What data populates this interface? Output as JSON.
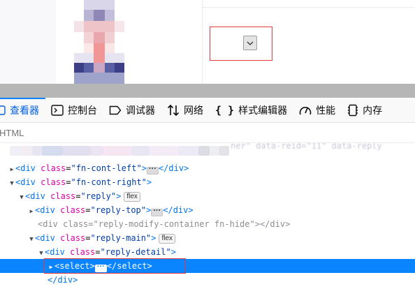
{
  "tabs": [
    {
      "label": "查看器",
      "icon": "inspector-icon",
      "selected": true
    },
    {
      "label": "控制台",
      "icon": "console-icon",
      "selected": false
    },
    {
      "label": "调试器",
      "icon": "debugger-icon",
      "selected": false
    },
    {
      "label": "网络",
      "icon": "network-icon",
      "selected": false
    },
    {
      "label": "样式编辑器",
      "icon": "style-editor-icon",
      "selected": false
    },
    {
      "label": "性能",
      "icon": "performance-icon",
      "selected": false
    },
    {
      "label": "内存",
      "icon": "memory-icon",
      "selected": false
    }
  ],
  "breadcrumb": "HTML",
  "colors": {
    "selection": "#0a84ff",
    "highlight_outline": "#e33b3b",
    "tag": "#0074e8",
    "attr_name": "#dd00a9",
    "attr_value": "#003eaa"
  },
  "tree": {
    "partial_top": "ner\" data-reid=\"11\" data-reply",
    "lines": {
      "l1": {
        "tag": "div",
        "attr": "class",
        "value": "fn-cont-left",
        "close": "</div>"
      },
      "l2": {
        "tag": "div",
        "attr": "class",
        "value": "fn-cont-right"
      },
      "l3": {
        "tag": "div",
        "attr": "class",
        "value": "reply",
        "badge": "flex"
      },
      "l4": {
        "tag": "div",
        "attr": "class",
        "value": "reply-top",
        "close": "</div>"
      },
      "l5": {
        "tag": "div",
        "attr": "class",
        "value": "reply-modify-container fn-hide",
        "close": "</div>"
      },
      "l6": {
        "tag": "div",
        "attr": "class",
        "value": "reply-main",
        "badge": "flex"
      },
      "l7": {
        "tag": "div",
        "attr": "class",
        "value": "reply-detail"
      },
      "l8": {
        "open": "<select>",
        "close": "</select>"
      },
      "l9": {
        "close": "</div>"
      }
    }
  }
}
